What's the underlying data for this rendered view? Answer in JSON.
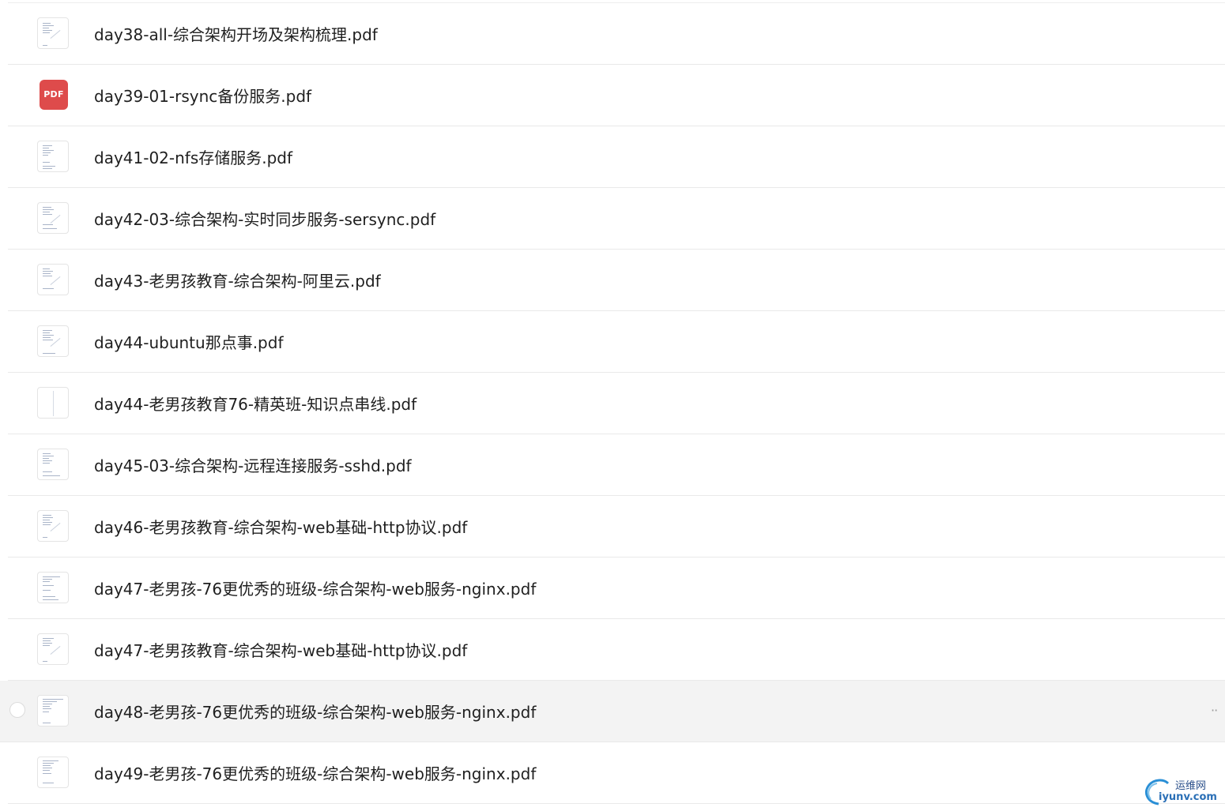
{
  "files": [
    {
      "name": "day38-all-综合架构开场及架构梳理.pdf",
      "thumb": "doc-thumb"
    },
    {
      "name": "day39-01-rsync备份服务.pdf",
      "thumb": "pdf-badge",
      "badge": "PDF"
    },
    {
      "name": "day41-02-nfs存储服务.pdf",
      "thumb": "doc-thumb"
    },
    {
      "name": "day42-03-综合架构-实时同步服务-sersync.pdf",
      "thumb": "doc-thumb"
    },
    {
      "name": "day43-老男孩教育-综合架构-阿里云.pdf",
      "thumb": "doc-thumb"
    },
    {
      "name": "day44-ubuntu那点事.pdf",
      "thumb": "doc-thumb"
    },
    {
      "name": "day44-老男孩教育76-精英班-知识点串线.pdf",
      "thumb": "sparse-thumb"
    },
    {
      "name": "day45-03-综合架构-远程连接服务-sshd.pdf",
      "thumb": "doc-thumb"
    },
    {
      "name": "day46-老男孩教育-综合架构-web基础-http协议.pdf",
      "thumb": "doc-thumb"
    },
    {
      "name": "day47-老男孩-76更优秀的班级-综合架构-web服务-nginx.pdf",
      "thumb": "doc-thumb"
    },
    {
      "name": "day47-老男孩教育-综合架构-web基础-http协议.pdf",
      "thumb": "doc-thumb"
    },
    {
      "name": "day48-老男孩-76更优秀的班级-综合架构-web服务-nginx.pdf",
      "thumb": "doc-thumb",
      "hovered": true
    },
    {
      "name": "day49-老男孩-76更优秀的班级-综合架构-web服务-nginx.pdf",
      "thumb": "doc-thumb"
    }
  ],
  "more_icon": "··",
  "watermark": {
    "cn": "运维网",
    "en": "iyunv.com"
  },
  "colors": {
    "hover_bg": "#f3f3f3",
    "pdf_badge": "#de4b4b",
    "divider": "#e9e9e9",
    "text": "#1f1f1f"
  }
}
